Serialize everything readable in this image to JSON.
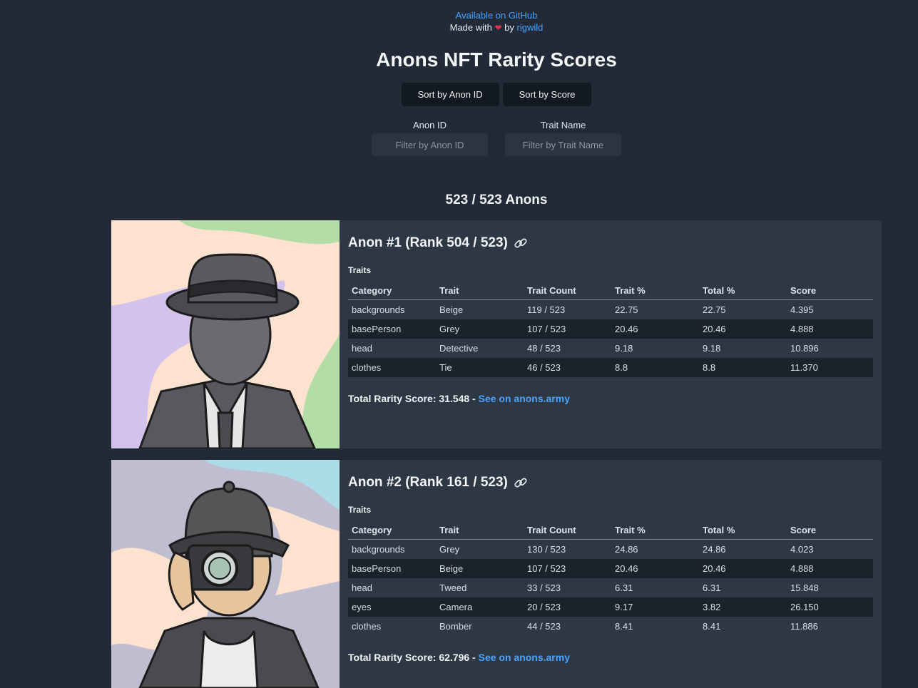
{
  "header": {
    "github_link": "Available on GitHub",
    "made_with": "Made with",
    "heart": "❤",
    "by": "by",
    "author": "rigwild"
  },
  "title": "Anons NFT Rarity Scores",
  "sort": {
    "by_id": "Sort by Anon ID",
    "by_score": "Sort by Score"
  },
  "filters": {
    "id_label": "Anon ID",
    "id_placeholder": "Filter by Anon ID",
    "trait_label": "Trait Name",
    "trait_placeholder": "Filter by Trait Name"
  },
  "count": "523 / 523 Anons",
  "columns": [
    "Category",
    "Trait",
    "Trait Count",
    "Trait %",
    "Total %",
    "Score"
  ],
  "traits_label": "Traits",
  "total_label": "Total Rarity Score:",
  "see_link": "See on anons.army",
  "anons": [
    {
      "title": "Anon #1 (Rank 504 / 523)",
      "total": "31.548",
      "rows": [
        [
          "backgrounds",
          "Beige",
          "119 / 523",
          "22.75",
          "22.75",
          "4.395"
        ],
        [
          "basePerson",
          "Grey",
          "107 / 523",
          "20.46",
          "20.46",
          "4.888"
        ],
        [
          "head",
          "Detective",
          "48 / 523",
          "9.18",
          "9.18",
          "10.896"
        ],
        [
          "clothes",
          "Tie",
          "46 / 523",
          "8.8",
          "8.8",
          "11.370"
        ]
      ]
    },
    {
      "title": "Anon #2 (Rank 161 / 523)",
      "total": "62.796",
      "rows": [
        [
          "backgrounds",
          "Grey",
          "130 / 523",
          "24.86",
          "24.86",
          "4.023"
        ],
        [
          "basePerson",
          "Beige",
          "107 / 523",
          "20.46",
          "20.46",
          "4.888"
        ],
        [
          "head",
          "Tweed",
          "33 / 523",
          "6.31",
          "6.31",
          "15.848"
        ],
        [
          "eyes",
          "Camera",
          "20 / 523",
          "9.17",
          "3.82",
          "26.150"
        ],
        [
          "clothes",
          "Bomber",
          "44 / 523",
          "8.41",
          "8.41",
          "11.886"
        ]
      ]
    }
  ]
}
